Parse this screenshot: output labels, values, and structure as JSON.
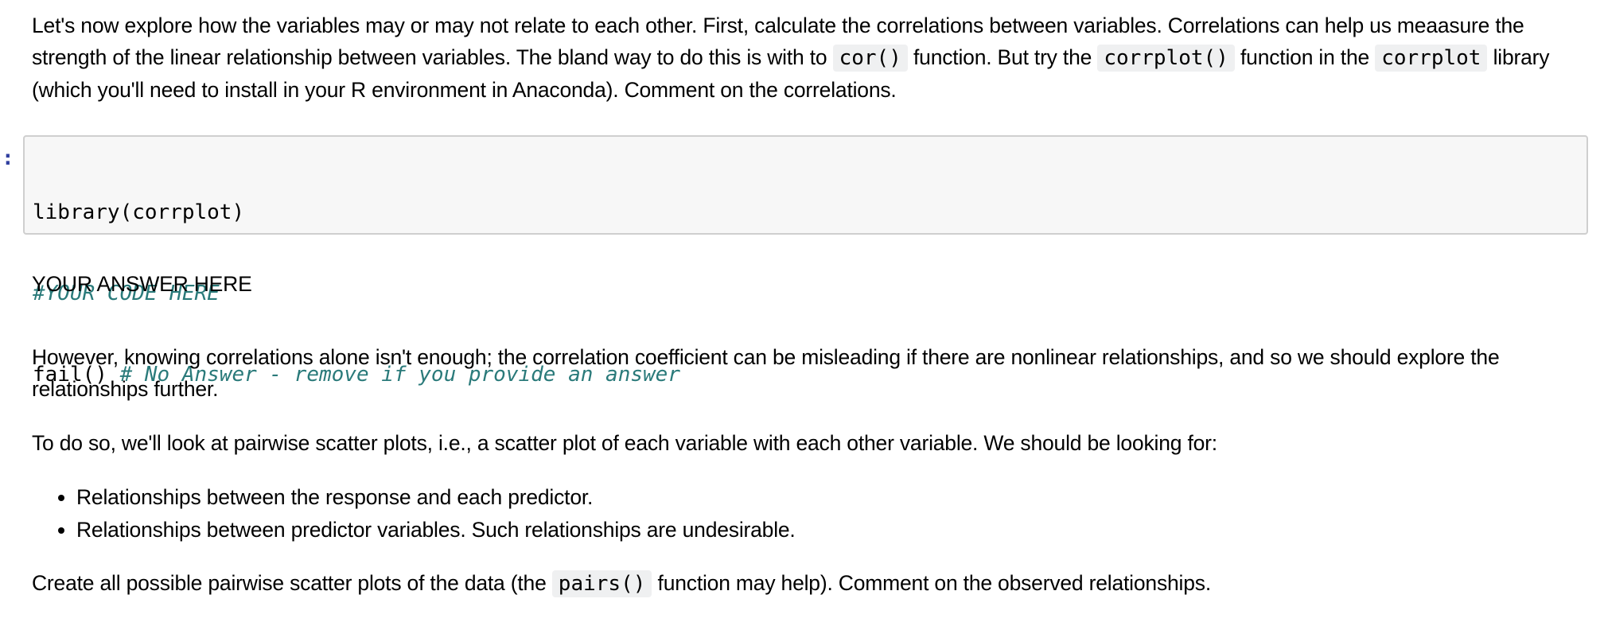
{
  "cells": {
    "intro": {
      "segments": [
        "Let's now explore how the variables may or may not relate to each other. First, calculate the correlations between variables. Correlations can help us meaasure the strength of the linear relationship between variables. The bland way to do this is with to ",
        "cor()",
        " function. But try the ",
        "corrplot()",
        " function in the ",
        "corrplot",
        " library (which you'll need to install in your R environment in Anaconda). Comment on the correlations."
      ]
    },
    "code": {
      "prompt": ":",
      "lines": [
        {
          "code": "library(corrplot)",
          "comment": ""
        },
        {
          "code": "",
          "comment": "#YOUR CODE HERE"
        },
        {
          "code": "fail() ",
          "comment": "# No Answer - remove if you provide an answer"
        }
      ]
    },
    "answer": {
      "text": "YOUR ANSWER HERE"
    },
    "however": {
      "text": "However, knowing correlations alone isn't enough; the correlation coefficient can be misleading if there are nonlinear relationships, and so we should explore the relationships further."
    },
    "todo": {
      "text": "To do so, we'll look at pairwise scatter plots, i.e., a scatter plot of each variable with each other variable. We should be looking for:"
    },
    "bullets": {
      "items": [
        "Relationships between the response and each predictor.",
        "Relationships between predictor variables. Such relationships are undesirable."
      ]
    },
    "create": {
      "segments": [
        "Create all possible pairwise scatter plots of the data (the ",
        "pairs()",
        " function may help). Comment on the observed relationships."
      ]
    }
  },
  "colors": {
    "prompt": "#303f9f",
    "comment": "#2a7a7a",
    "code_bg": "#f7f7f7",
    "code_border": "#cfcfcf",
    "inline_code_bg": "#eff0f1"
  }
}
